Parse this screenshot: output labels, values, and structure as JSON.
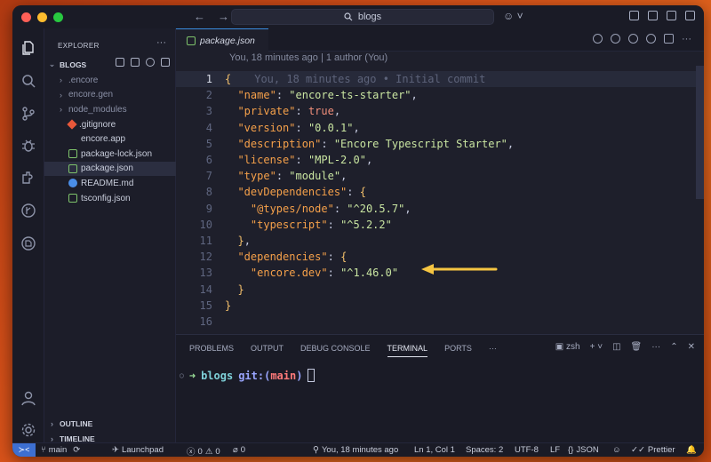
{
  "titlebar": {
    "search_text": "blogs"
  },
  "sidebar": {
    "title": "EXPLORER",
    "root_label": "BLOGS",
    "items": [
      {
        "label": ".encore",
        "type": "folder",
        "dim": true
      },
      {
        "label": "encore.gen",
        "type": "folder",
        "dim": true
      },
      {
        "label": "node_modules",
        "type": "folder",
        "dim": true
      },
      {
        "label": ".gitignore",
        "type": "git-icon"
      },
      {
        "label": "encore.app",
        "type": "file"
      },
      {
        "label": "package-lock.json",
        "type": "json-icon"
      },
      {
        "label": "package.json",
        "type": "json-icon",
        "selected": true
      },
      {
        "label": "README.md",
        "type": "info-icon"
      },
      {
        "label": "tsconfig.json",
        "type": "json-icon"
      }
    ],
    "outline_label": "OUTLINE",
    "timeline_label": "TIMELINE"
  },
  "editor": {
    "tab_label": "package.json",
    "breadcrumb": "You, 18 minutes ago | 1 author (You)",
    "blame": "You, 18 minutes ago • Initial commit",
    "line_numbers": [
      "1",
      "2",
      "3",
      "4",
      "5",
      "6",
      "7",
      "8",
      "9",
      "10",
      "11",
      "12",
      "13",
      "14",
      "15",
      "16"
    ]
  },
  "code": {
    "l2_key": "\"name\"",
    "l2_val": "\"encore-ts-starter\"",
    "l3_key": "\"private\"",
    "l3_val": "true",
    "l4_key": "\"version\"",
    "l4_val": "\"0.0.1\"",
    "l5_key": "\"description\"",
    "l5_val": "\"Encore Typescript Starter\"",
    "l6_key": "\"license\"",
    "l6_val": "\"MPL-2.0\"",
    "l7_key": "\"type\"",
    "l7_val": "\"module\"",
    "l8_key": "\"devDependencies\"",
    "l9_key": "\"@types/node\"",
    "l9_val": "\"^20.5.7\"",
    "l10_key": "\"typescript\"",
    "l10_val": "\"^5.2.2\"",
    "l12_key": "\"dependencies\"",
    "l13_key": "\"encore.dev\"",
    "l13_val": "\"^1.46.0\""
  },
  "panel": {
    "tabs": [
      "PROBLEMS",
      "OUTPUT",
      "DEBUG CONSOLE",
      "TERMINAL",
      "PORTS"
    ],
    "active_tab": "TERMINAL",
    "shell": "zsh",
    "prompt_dir": "blogs",
    "prompt_git": "git:(",
    "prompt_branch": "main",
    "prompt_close": ")"
  },
  "statusbar": {
    "branch": "main",
    "launchpad": "Launchpad",
    "errors": "0",
    "warnings": "0",
    "ports": "0",
    "blame": "You, 18 minutes ago",
    "position": "Ln 1, Col 1",
    "spaces": "Spaces: 2",
    "encoding": "UTF-8",
    "eol": "LF",
    "language": "JSON",
    "prettier": "Prettier"
  },
  "colors": {
    "accent": "#3d6fd1",
    "arrow": "#f5c542"
  }
}
